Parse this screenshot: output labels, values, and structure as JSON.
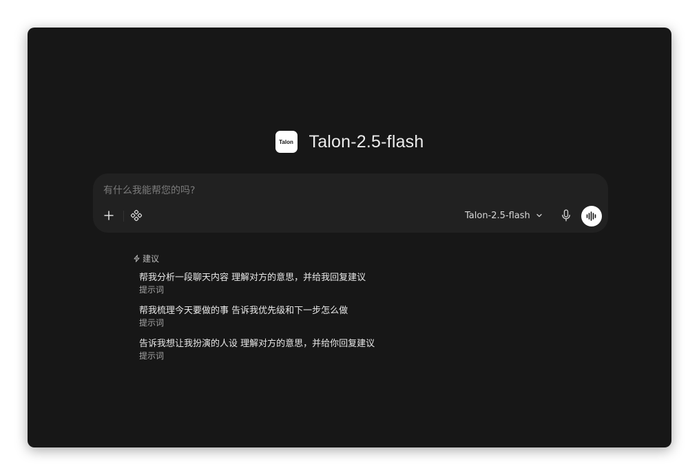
{
  "header": {
    "logo_text": "Talon",
    "title": "Talon-2.5-flash"
  },
  "composer": {
    "placeholder": "有什么我能帮您的吗?",
    "value": "",
    "model_label": "Talon-2.5-flash",
    "icons": {
      "add": "plus-icon",
      "tools": "tools-icon",
      "model_dropdown": "chevron-down-icon",
      "mic": "microphone-icon",
      "voice": "voice-wave-icon"
    }
  },
  "suggestions": {
    "header": "建议",
    "header_icon": "lightning-icon",
    "items": [
      {
        "text": "帮我分析一段聊天内容 理解对方的意思，并给我回复建议",
        "sub": "提示词"
      },
      {
        "text": "帮我梳理今天要做的事 告诉我优先级和下一步怎么做",
        "sub": "提示词"
      },
      {
        "text": "告诉我想让我扮演的人设 理解对方的意思，并给你回复建议",
        "sub": "提示词"
      }
    ]
  },
  "colors": {
    "window_bg": "#171717",
    "composer_bg": "#212121",
    "text_primary": "#ececec",
    "text_secondary": "#a6a6a6"
  }
}
